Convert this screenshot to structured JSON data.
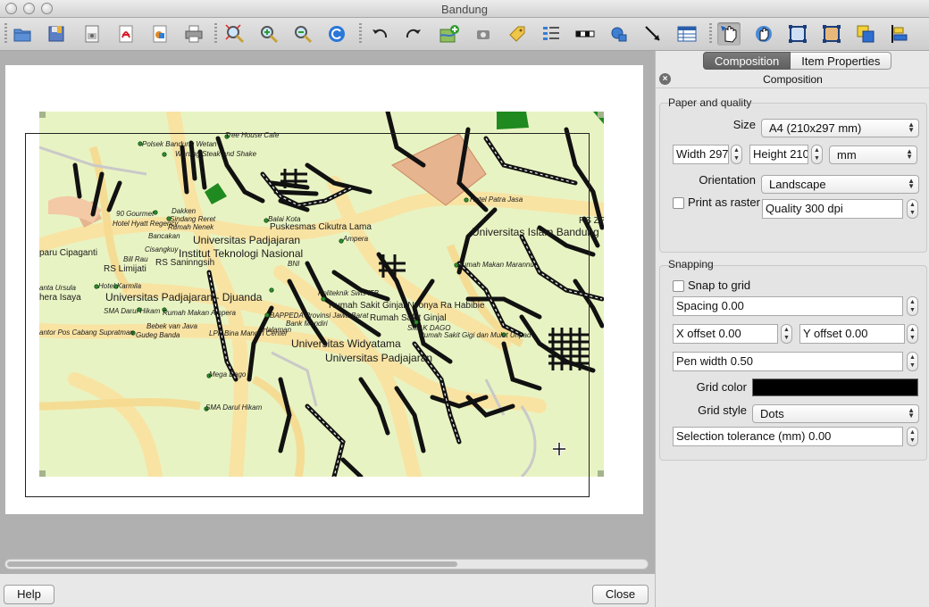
{
  "window": {
    "title": "Bandung"
  },
  "toolbar": {
    "items": [
      "open-composer-icon",
      "save-icon",
      "export-image-icon",
      "export-pdf-icon",
      "export-svg-icon",
      "print-icon",
      "zoom-full-icon",
      "zoom-in-icon",
      "zoom-out-icon",
      "refresh-icon",
      "undo-icon",
      "redo-icon",
      "add-map-icon",
      "add-image-icon",
      "add-label-icon",
      "add-legend-icon",
      "add-scalebar-icon",
      "add-shape-icon",
      "add-arrow-icon",
      "add-table-icon",
      "select-move-item-icon",
      "move-item-content-icon",
      "group-icon",
      "ungroup-icon",
      "raise-icon",
      "align-icon"
    ]
  },
  "map": {
    "labels": [
      "Polsek Bandung Wetan",
      "Tree House Cafe",
      "Warung Steak and Shake",
      "Hotel Patra Jasa",
      "Dakken",
      "90 Gourmet",
      "Sindang Reret",
      "Hotel Hyatt Regency",
      "Rumah Nenek",
      "Balai Kota",
      "Puskesmas Cikutra Lama",
      "RS ZP",
      "Universitas Islam Bandung",
      "Bancakan",
      "Universitas Padjajaran",
      "Ampera",
      "Cisangkuy",
      "Institut Teknologi Nasional",
      "paru Cipaganti",
      "Bill Rau",
      "RS Saninngsih",
      "BNI",
      "Rumah Makan Marannu",
      "RS Limijati",
      "Hotel Karmila",
      "Universitas Padjajaran - Djuanda",
      "anta Ursula",
      "hera Isaya",
      "Politeknik Swis ITB",
      "Rumah Sakit Ginjal Nyonya Ra Habibie",
      "SMA Darul Hikam",
      "Rumah Makan Ampera",
      "BAPPEDA Provinsi Jawa Barat",
      "Rumah Sakit Ginjal",
      "Bank Mandiri",
      "Halaman",
      "Bebek van Java",
      "SMAK DAGO",
      "antor Pos Cabang Supratman",
      "LPP Bina Mandiri Center",
      "Rumah Sakit Gigi dan Mulut Unpad",
      "Gudeg Banda",
      "Universitas Widyatama",
      "Universitas Padjajaran",
      "Mega Dago",
      "SMA Darul Hikam"
    ]
  },
  "dock": {
    "tabs": [
      "Composition",
      "Item Properties"
    ],
    "panel_title": "Composition",
    "paper": {
      "group_label": "Paper and quality",
      "size_label": "Size",
      "size_value": "A4 (210x297 mm)",
      "width_value": "Width 297",
      "height_value": "Height 210",
      "units_value": "mm",
      "orientation_label": "Orientation",
      "orientation_value": "Landscape",
      "print_raster_label": "Print as raster",
      "print_raster_checked": false,
      "quality_value": "Quality 300 dpi"
    },
    "snapping": {
      "group_label": "Snapping",
      "snap_label": "Snap to grid",
      "snap_checked": false,
      "spacing_value": "Spacing 0.00",
      "x_offset_value": "X offset 0.00",
      "y_offset_value": "Y offset 0.00",
      "pen_width_value": "Pen width 0.50",
      "grid_color_label": "Grid color",
      "grid_color": "#000000",
      "grid_style_label": "Grid style",
      "grid_style_value": "Dots",
      "tolerance_value": "Selection tolerance (mm) 0.00"
    }
  },
  "footer": {
    "help_label": "Help",
    "close_label": "Close"
  }
}
